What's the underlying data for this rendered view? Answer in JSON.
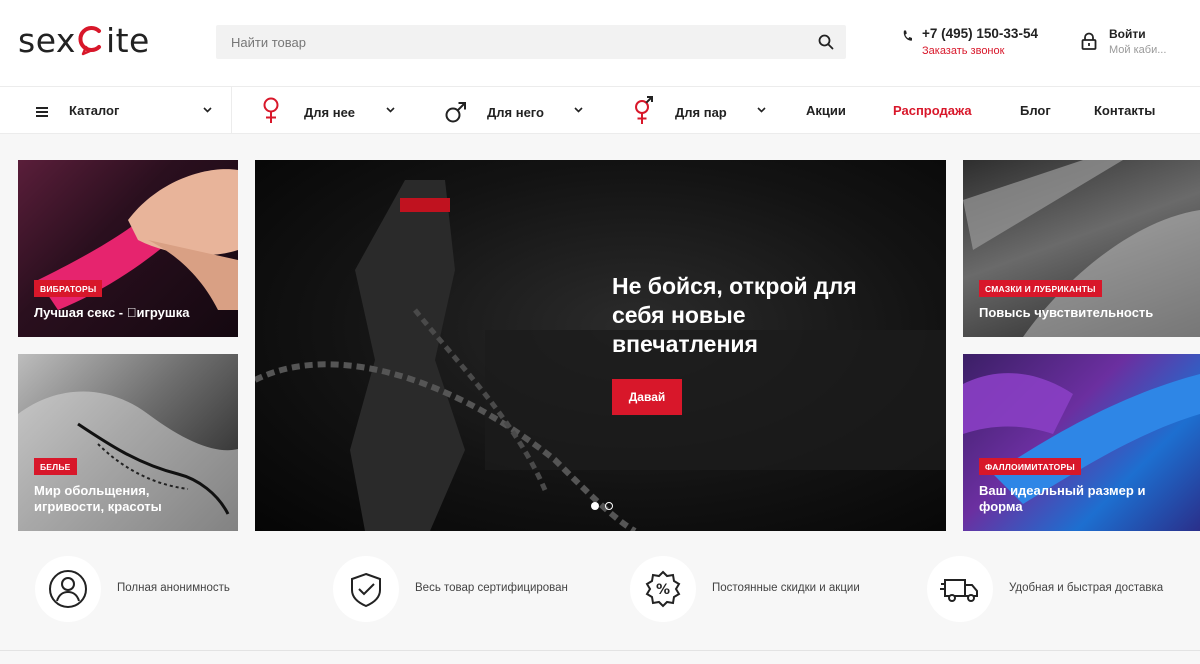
{
  "header": {
    "logo": {
      "prefix": "sex",
      "suffix": "ite"
    },
    "search": {
      "placeholder": "Найти товар"
    },
    "phone": "+7 (495) 150-33-54",
    "callback_label": "Заказать звонок",
    "login_label": "Войти",
    "cabinet_label": "Мой каби..."
  },
  "nav": {
    "catalog_label": "Каталог",
    "for_her": "Для нее",
    "for_him": "Для него",
    "for_couples": "Для пар",
    "promo": "Акции",
    "sale": "Распродажа",
    "blog": "Блог",
    "contacts": "Контакты"
  },
  "tiles": [
    {
      "badge": "Вибраторы",
      "caption": "Лучшая секс - \u0000игрушка"
    },
    {
      "badge": "Белье",
      "caption": "Мир обольщения, игривости, красоты"
    },
    {
      "badge": "Смазки и лубриканты",
      "caption": "Повысь чувствительность"
    },
    {
      "badge": "Фаллоимитаторы",
      "caption": "Ваш идеальный размер и форма"
    }
  ],
  "hero": {
    "title": "Не бойся, открой для себя новые впечатления",
    "cta_label": "Давай",
    "slides_total": 2,
    "active_slide": 1
  },
  "features": [
    {
      "icon": "user-icon",
      "text": "Полная анонимность"
    },
    {
      "icon": "shield-check-icon",
      "text": "Весь товар сертифицирован"
    },
    {
      "icon": "percent-badge-icon",
      "text": "Постоянные скидки и акции"
    },
    {
      "icon": "delivery-truck-icon",
      "text": "Удобная и быстрая доставка"
    }
  ],
  "colors": {
    "accent": "#d8172a",
    "text": "#222222",
    "background": "#f7f7f7"
  }
}
